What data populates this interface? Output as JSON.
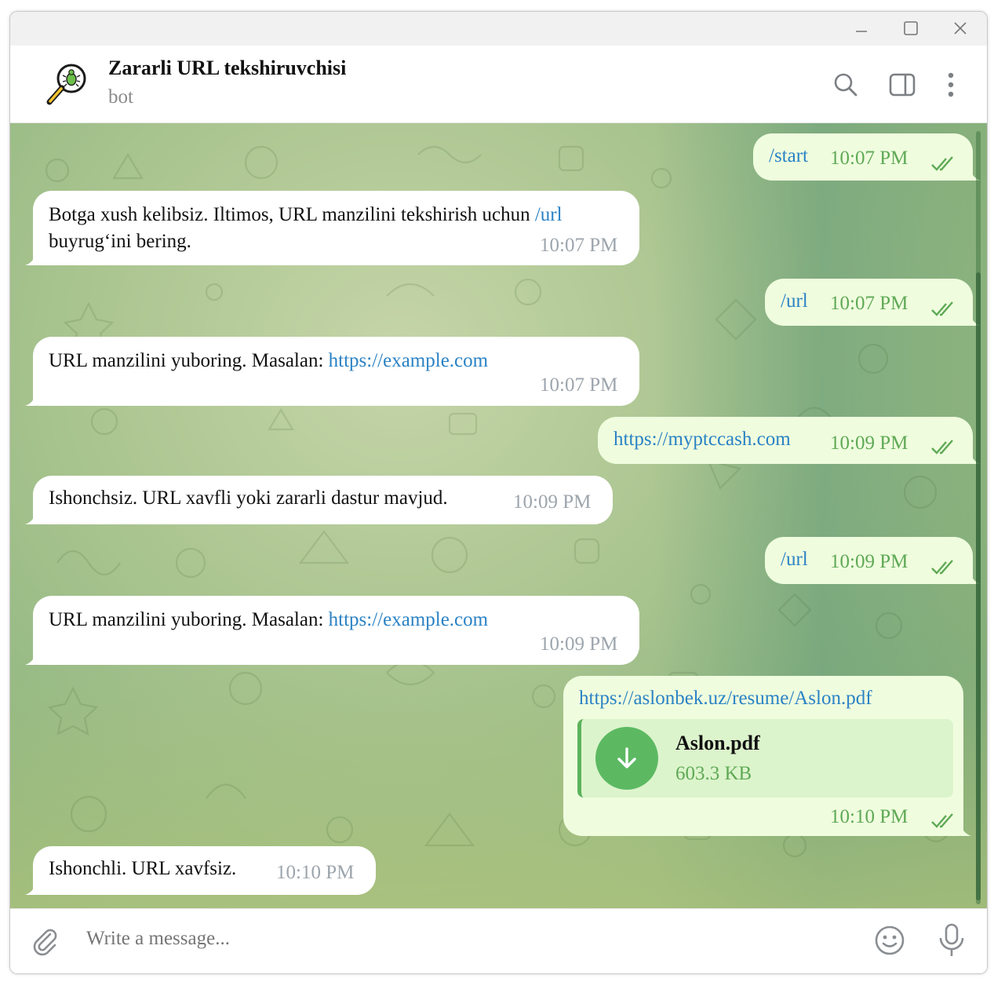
{
  "header": {
    "title": "Zararli URL tekshiruvchisi",
    "subtitle": "bot"
  },
  "icons": {
    "avatar": "magnifier-bug-icon",
    "search": "search-icon",
    "sidebar": "sidebar-toggle-icon",
    "menu": "more-vertical-icon",
    "attach": "paperclip-icon",
    "emoji": "emoji-icon",
    "mic": "microphone-icon",
    "download": "download-arrow-icon"
  },
  "colors": {
    "link": "#2a82c5",
    "outgoing_bubble": "#effdde",
    "read_ticks": "#5fa956",
    "file_accent": "#5cb962"
  },
  "messages": [
    {
      "dir": "out",
      "text": "/start",
      "time": "10:07 PM"
    },
    {
      "dir": "in",
      "text1": "Botga xush kelibsiz. Iltimos, URL manzilini tekshirish uchun ",
      "link": "/url",
      "text2": "buyrug‘ini bering.",
      "time": "10:07 PM"
    },
    {
      "dir": "out",
      "text": "/url",
      "time": "10:07 PM"
    },
    {
      "dir": "in",
      "text": "URL manzilini yuboring. Masalan: ",
      "link": "https://example.com",
      "time": "10:07 PM"
    },
    {
      "dir": "out",
      "text": "https://myptccash.com",
      "time": "10:09 PM"
    },
    {
      "dir": "in",
      "text": "Ishonchsiz. URL xavfli yoki zararli dastur mavjud.",
      "time": "10:09 PM"
    },
    {
      "dir": "out",
      "text": "/url",
      "time": "10:09 PM"
    },
    {
      "dir": "in",
      "text": "URL manzilini yuboring. Masalan: ",
      "link": "https://example.com",
      "time": "10:09 PM"
    },
    {
      "dir": "out",
      "text": "https://aslonbek.uz/resume/Aslon.pdf",
      "file": {
        "name": "Aslon.pdf",
        "size": "603.3 KB"
      },
      "time": "10:10 PM"
    },
    {
      "dir": "in",
      "text": "Ishonchli. URL xavfsiz.",
      "time": "10:10 PM"
    }
  ],
  "composer": {
    "placeholder": "Write a message..."
  }
}
